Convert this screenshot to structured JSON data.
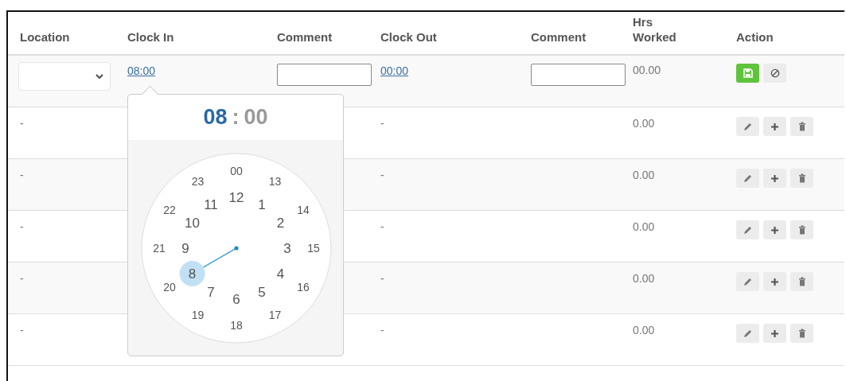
{
  "table": {
    "columns": [
      {
        "lines": [
          "Location"
        ]
      },
      {
        "lines": [
          "Clock In"
        ]
      },
      {
        "lines": [
          "Comment"
        ]
      },
      {
        "lines": [
          "Clock Out"
        ]
      },
      {
        "lines": [
          "Comment"
        ]
      },
      {
        "lines": [
          "Hrs",
          "Worked"
        ]
      },
      {
        "lines": [
          "Action"
        ]
      }
    ],
    "edit_row": {
      "clock_in": "08:00",
      "clock_out": "00:00",
      "hrs_worked": "00.00",
      "actions": [
        {
          "kind": "save"
        },
        {
          "kind": "cancel"
        }
      ]
    },
    "rows": [
      {
        "location": "-",
        "clock_out": "-",
        "hrs_worked": "0.00",
        "actions": [
          {
            "kind": "edit"
          },
          {
            "kind": "add"
          },
          {
            "kind": "delete"
          }
        ]
      },
      {
        "location": "-",
        "clock_out": "-",
        "hrs_worked": "0.00",
        "actions": [
          {
            "kind": "edit"
          },
          {
            "kind": "add"
          },
          {
            "kind": "delete"
          }
        ]
      },
      {
        "location": "-",
        "clock_out": "-",
        "hrs_worked": "0.00",
        "actions": [
          {
            "kind": "edit"
          },
          {
            "kind": "add"
          },
          {
            "kind": "delete"
          }
        ]
      },
      {
        "location": "-",
        "clock_out": "-",
        "hrs_worked": "0.00",
        "actions": [
          {
            "kind": "edit"
          },
          {
            "kind": "add"
          },
          {
            "kind": "delete"
          }
        ]
      },
      {
        "location": "-",
        "clock_out": "-",
        "hrs_worked": "0.00",
        "actions": [
          {
            "kind": "edit"
          },
          {
            "kind": "add"
          },
          {
            "kind": "delete"
          }
        ]
      }
    ]
  },
  "time_picker": {
    "hours": {
      "text": "08",
      "selected": true
    },
    "separator": ":",
    "minutes": {
      "text": "00",
      "selected": false
    },
    "dial": [
      {
        "label": "12",
        "selected": false
      },
      {
        "label": "1",
        "selected": false
      },
      {
        "label": "2",
        "selected": false
      },
      {
        "label": "3",
        "selected": false
      },
      {
        "label": "4",
        "selected": false
      },
      {
        "label": "5",
        "selected": false
      },
      {
        "label": "6",
        "selected": false
      },
      {
        "label": "7",
        "selected": false
      },
      {
        "label": "8",
        "selected": true
      },
      {
        "label": "9",
        "selected": false
      },
      {
        "label": "10",
        "selected": false
      },
      {
        "label": "11",
        "selected": false
      },
      {
        "label": "00",
        "selected": false
      },
      {
        "label": "13",
        "selected": false
      },
      {
        "label": "14",
        "selected": false
      },
      {
        "label": "15",
        "selected": false
      },
      {
        "label": "16",
        "selected": false
      },
      {
        "label": "17",
        "selected": false
      },
      {
        "label": "18",
        "selected": false
      },
      {
        "label": "19",
        "selected": false
      },
      {
        "label": "20",
        "selected": false
      },
      {
        "label": "21",
        "selected": false
      },
      {
        "label": "22",
        "selected": false
      },
      {
        "label": "23",
        "selected": false
      }
    ]
  }
}
